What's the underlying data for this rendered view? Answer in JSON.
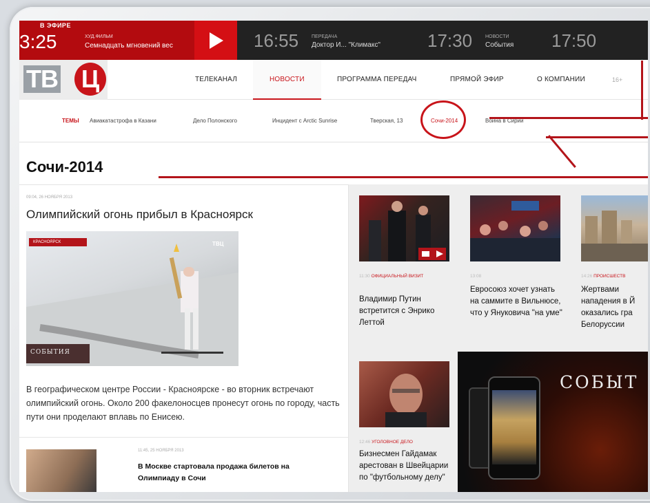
{
  "now_playing": {
    "tag": "В ЭФИРЕ",
    "time": "3:25",
    "genre": "ХУД.ФИЛЬМ",
    "title": "Семнадцать мгновений вес"
  },
  "schedule": [
    {
      "time": "16:55",
      "category": "ПЕРЕДАЧА",
      "name": "Доктор И... \"Климакс\""
    },
    {
      "time": "17:30",
      "category": "НОВОСТИ",
      "name": "События"
    },
    {
      "time": "17:50",
      "category": "",
      "name": ""
    }
  ],
  "logo": {
    "left": "ТВ",
    "right": "Ц"
  },
  "nav": [
    "ТЕЛЕКАНАЛ",
    "НОВОСТИ",
    "ПРОГРАММА ПЕРЕДАЧ",
    "ПРЯМОЙ ЭФИР",
    "О КОМПАНИИ"
  ],
  "age_rating": "16+",
  "topics": {
    "label": "ТЕМЫ",
    "items": [
      "Авиакатастрофа в Казани",
      "Дело Полонского",
      "Инцидент с Arctic Sunrise",
      "Тверская, 13",
      "Сочи-2014",
      "Война в Сирии"
    ]
  },
  "page_title": "Сочи-2014",
  "main_story": {
    "date": "09:04, 26 НОЯБРЯ 2013",
    "title": "Олимпийский огонь прибыл в Красноярск",
    "photo_caption_top": "КРАСНОЯРСК",
    "photo_logo": "ТВЦ",
    "photo_caption_bottom": "СОБЫТИЯ",
    "lead": "В географическом центре России - Красноярске - во вторник встречают олимпийский огонь. Около 200 факелоносцев пронесут огонь по городу, часть пути они проделают вплавь по Енисею."
  },
  "secondary_story": {
    "date": "11:45, 25 НОЯБРЯ 2013",
    "title": "В Москве стартовала продажа билетов на Олимпиаду в Сочи"
  },
  "cards": [
    {
      "time": "11:30",
      "category": "ОФИЦИАЛЬНЫЙ ВИЗИТ",
      "title": "Владимир Путин встретится с Энрико Леттой"
    },
    {
      "time": "13:08",
      "category": "",
      "title": "Евросоюз хочет узнать на саммите в Вильнюсе, что у Януковича \"на уме\""
    },
    {
      "time": "14:26",
      "category": "ПРОИСШЕСТВ",
      "title": "Жертвами нападения в Й оказались гра Белоруссии"
    },
    {
      "time": "12:46",
      "category": "УГОЛОВНОЕ ДЕЛО",
      "title": "Бизнесмен Гайдамак арестован в Швейцарии по \"футбольному делу\""
    }
  ],
  "promo": {
    "word": "СОБЫТ"
  },
  "colors": {
    "brand_red": "#c8141a",
    "dark_bar": "#222222",
    "now_red": "#b30b0f"
  }
}
